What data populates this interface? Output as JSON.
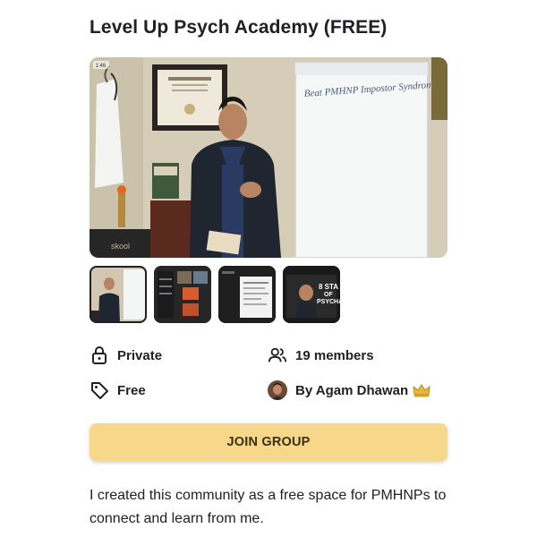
{
  "group": {
    "title": "Level Up Psych Academy (FREE)",
    "description": "I created this community as a free space for PMHNPs to connect and learn from me."
  },
  "hero": {
    "whiteboard_text": "Beat PMHNP Impostor Syndrome",
    "brand_watermark": "skool",
    "badge": "1:46"
  },
  "thumbnails": [
    {
      "name": "thumb-video",
      "selected": true
    },
    {
      "name": "thumb-course-grid",
      "selected": false
    },
    {
      "name": "thumb-document",
      "selected": false
    },
    {
      "name": "thumb-stages",
      "selected": false,
      "overlay_text": "8 STA OF PSYCHA"
    }
  ],
  "meta": {
    "privacy": {
      "icon": "lock-icon",
      "label": "Private"
    },
    "members": {
      "icon": "people-icon",
      "label": "19 members"
    },
    "price": {
      "icon": "tag-icon",
      "label": "Free"
    },
    "owner": {
      "icon": "crown-icon",
      "label": "By Agam Dhawan"
    }
  },
  "cta": {
    "label": "JOIN GROUP",
    "color": "#f7d78a"
  }
}
